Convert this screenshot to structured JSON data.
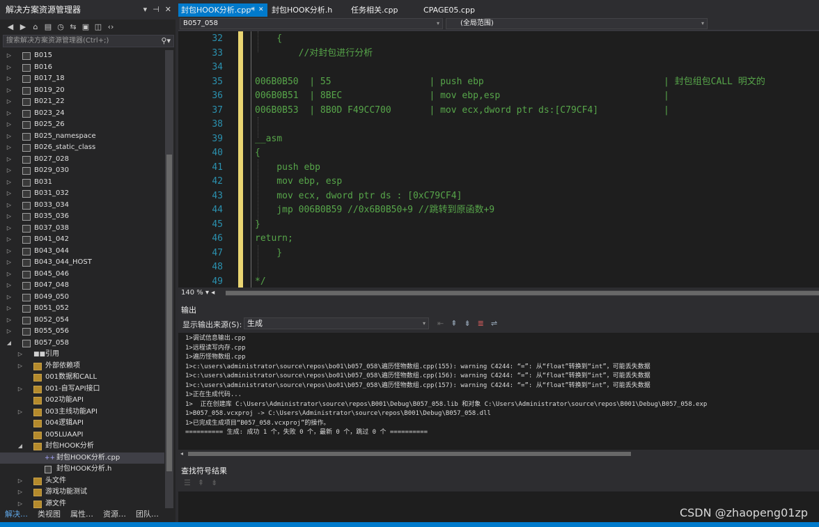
{
  "solution_explorer": {
    "title": "解决方案资源管理器",
    "title_buttons": [
      "▾",
      "⊣",
      "✕"
    ],
    "toolbar_icons": [
      "back-icon",
      "forward-icon",
      "home-icon",
      "switch-views-icon",
      "pending-changes-icon",
      "sync-icon",
      "collapse-all-icon",
      "show-all-files-icon",
      "code-view-icon"
    ],
    "search_placeholder": "搜索解决方案资源管理器(Ctrl+;)",
    "items": [
      {
        "label": "B015",
        "indent": 1,
        "arrow": "▷",
        "icon": "project"
      },
      {
        "label": "B016",
        "indent": 1,
        "arrow": "▷",
        "icon": "project"
      },
      {
        "label": "B017_18",
        "indent": 1,
        "arrow": "▷",
        "icon": "project"
      },
      {
        "label": "B019_20",
        "indent": 1,
        "arrow": "▷",
        "icon": "project"
      },
      {
        "label": "B021_22",
        "indent": 1,
        "arrow": "▷",
        "icon": "project"
      },
      {
        "label": "B023_24",
        "indent": 1,
        "arrow": "▷",
        "icon": "project"
      },
      {
        "label": "B025_26",
        "indent": 1,
        "arrow": "▷",
        "icon": "project"
      },
      {
        "label": "B025_namespace",
        "indent": 1,
        "arrow": "▷",
        "icon": "project"
      },
      {
        "label": "B026_static_class",
        "indent": 1,
        "arrow": "▷",
        "icon": "project"
      },
      {
        "label": "B027_028",
        "indent": 1,
        "arrow": "▷",
        "icon": "project"
      },
      {
        "label": "B029_030",
        "indent": 1,
        "arrow": "▷",
        "icon": "project"
      },
      {
        "label": "B031",
        "indent": 1,
        "arrow": "▷",
        "icon": "project"
      },
      {
        "label": "B031_032",
        "indent": 1,
        "arrow": "▷",
        "icon": "project"
      },
      {
        "label": "B033_034",
        "indent": 1,
        "arrow": "▷",
        "icon": "project"
      },
      {
        "label": "B035_036",
        "indent": 1,
        "arrow": "▷",
        "icon": "project"
      },
      {
        "label": "B037_038",
        "indent": 1,
        "arrow": "▷",
        "icon": "project"
      },
      {
        "label": "B041_042",
        "indent": 1,
        "arrow": "▷",
        "icon": "project"
      },
      {
        "label": "B043_044",
        "indent": 1,
        "arrow": "▷",
        "icon": "project"
      },
      {
        "label": "B043_044_HOST",
        "indent": 1,
        "arrow": "▷",
        "icon": "project"
      },
      {
        "label": "B045_046",
        "indent": 1,
        "arrow": "▷",
        "icon": "project"
      },
      {
        "label": "B047_048",
        "indent": 1,
        "arrow": "▷",
        "icon": "project"
      },
      {
        "label": "B049_050",
        "indent": 1,
        "arrow": "▷",
        "icon": "project"
      },
      {
        "label": "B051_052",
        "indent": 1,
        "arrow": "▷",
        "icon": "project"
      },
      {
        "label": "B052_054",
        "indent": 1,
        "arrow": "▷",
        "icon": "project"
      },
      {
        "label": "B055_056",
        "indent": 1,
        "arrow": "▷",
        "icon": "project"
      },
      {
        "label": "B057_058",
        "indent": 1,
        "arrow": "◢",
        "icon": "project"
      },
      {
        "label": "引用",
        "indent": 2,
        "arrow": "▷",
        "icon": "references"
      },
      {
        "label": "外部依赖项",
        "indent": 2,
        "arrow": "▷",
        "icon": "folder"
      },
      {
        "label": "001数据和CALL",
        "indent": 2,
        "arrow": "",
        "icon": "folder"
      },
      {
        "label": "001-自写API接口",
        "indent": 2,
        "arrow": "▷",
        "icon": "folder"
      },
      {
        "label": "002功能API",
        "indent": 2,
        "arrow": "",
        "icon": "folder"
      },
      {
        "label": "003主线功能API",
        "indent": 2,
        "arrow": "▷",
        "icon": "folder"
      },
      {
        "label": "004逻辑API",
        "indent": 2,
        "arrow": "",
        "icon": "folder"
      },
      {
        "label": "005LUAAPI",
        "indent": 2,
        "arrow": "",
        "icon": "folder"
      },
      {
        "label": "封包HOOK分析",
        "indent": 2,
        "arrow": "◢",
        "icon": "folder-open"
      },
      {
        "label": "封包HOOK分析.cpp",
        "indent": 3,
        "arrow": "",
        "icon": "cpp-file",
        "selected": true
      },
      {
        "label": "封包HOOK分析.h",
        "indent": 3,
        "arrow": "",
        "icon": "header-file"
      },
      {
        "label": "头文件",
        "indent": 2,
        "arrow": "▷",
        "icon": "folder"
      },
      {
        "label": "游戏功能测试",
        "indent": 2,
        "arrow": "▷",
        "icon": "folder"
      },
      {
        "label": "源文件",
        "indent": 2,
        "arrow": "▷",
        "icon": "folder"
      }
    ],
    "bottom_tabs": [
      {
        "label": "解决…",
        "active": true
      },
      {
        "label": "类视图",
        "active": false
      },
      {
        "label": "属性…",
        "active": false
      },
      {
        "label": "资源…",
        "active": false
      },
      {
        "label": "团队…",
        "active": false
      }
    ]
  },
  "document_tabs": [
    {
      "label": "封包HOOK分析.cpp*",
      "active": true,
      "pin": "⊣",
      "close": "✕"
    },
    {
      "label": "封包HOOK分析.h",
      "active": false
    },
    {
      "label": "任务相关.cpp",
      "active": false
    },
    {
      "label": "CPAGE05.cpp",
      "active": false
    }
  ],
  "nav_bar": {
    "project": "B057_058",
    "scope": "(全局范围)"
  },
  "editor": {
    "lines": [
      {
        "n": "32",
        "text": "    {"
      },
      {
        "n": "33",
        "text": "        //对封包进行分析"
      },
      {
        "n": "34",
        "text": ""
      },
      {
        "n": "35",
        "text": "006B0B50  | 55                  | push ebp                                 | 封包组包CALL 明文的"
      },
      {
        "n": "36",
        "text": "006B0B51  | 8BEC                | mov ebp,esp                              |"
      },
      {
        "n": "37",
        "text": "006B0B53  | 8B0D F49CC700       | mov ecx,dword ptr ds:[C79CF4]            |"
      },
      {
        "n": "38",
        "text": ""
      },
      {
        "n": "39",
        "text": "__asm"
      },
      {
        "n": "40",
        "text": "{"
      },
      {
        "n": "41",
        "text": "    push ebp"
      },
      {
        "n": "42",
        "text": "    mov ebp, esp"
      },
      {
        "n": "43",
        "text": "    mov ecx, dword ptr ds : [0xC79CF4]"
      },
      {
        "n": "44",
        "text": "    jmp 006B0B59 //0x6B0B50+9 //跳转到原函数+9"
      },
      {
        "n": "45",
        "text": "}"
      },
      {
        "n": "46",
        "text": "return;"
      },
      {
        "n": "47",
        "text": "    }"
      },
      {
        "n": "48",
        "text": ""
      },
      {
        "n": "49",
        "text": "*/"
      }
    ],
    "zoom": "140 %",
    "colors": {
      "comment": "#57a64a",
      "line_number": "#2b91af",
      "change_marker": "#ead572"
    }
  },
  "output": {
    "title": "输出",
    "source_label": "显示输出来源(S):",
    "source_value": "生成",
    "lines": [
      "1>调试信息输出.cpp",
      "1>远程读写内存.cpp",
      "1>遍历怪物数组.cpp",
      "1>c:\\users\\administrator\\source\\repos\\bo01\\b057_058\\遍历怪物数组.cpp(155): warning C4244: “=”: 从“float”转换到“int”，可能丢失数据",
      "1>c:\\users\\administrator\\source\\repos\\bo01\\b057_058\\遍历怪物数组.cpp(156): warning C4244: “=”: 从“float”转换到“int”，可能丢失数据",
      "1>c:\\users\\administrator\\source\\repos\\bo01\\b057_058\\遍历怪物数组.cpp(157): warning C4244: “=”: 从“float”转换到“int”，可能丢失数据",
      "1>正在生成代码...",
      "1>  正在创建库 C:\\Users\\Administrator\\source\\repos\\B001\\Debug\\B057_058.lib 和对象 C:\\Users\\Administrator\\source\\repos\\B001\\Debug\\B057_058.exp",
      "1>B057_058.vcxproj -> C:\\Users\\Administrator\\source\\repos\\B001\\Debug\\B057_058.dll",
      "1>已完成生成项目“B057_058.vcxproj”的操作。",
      "========== 生成: 成功 1 个，失败 0 个，最新 0 个，跳过 0 个 =========="
    ]
  },
  "find_symbol": {
    "title": "查找符号结果"
  },
  "watermark": "CSDN @zhaopeng01zp"
}
